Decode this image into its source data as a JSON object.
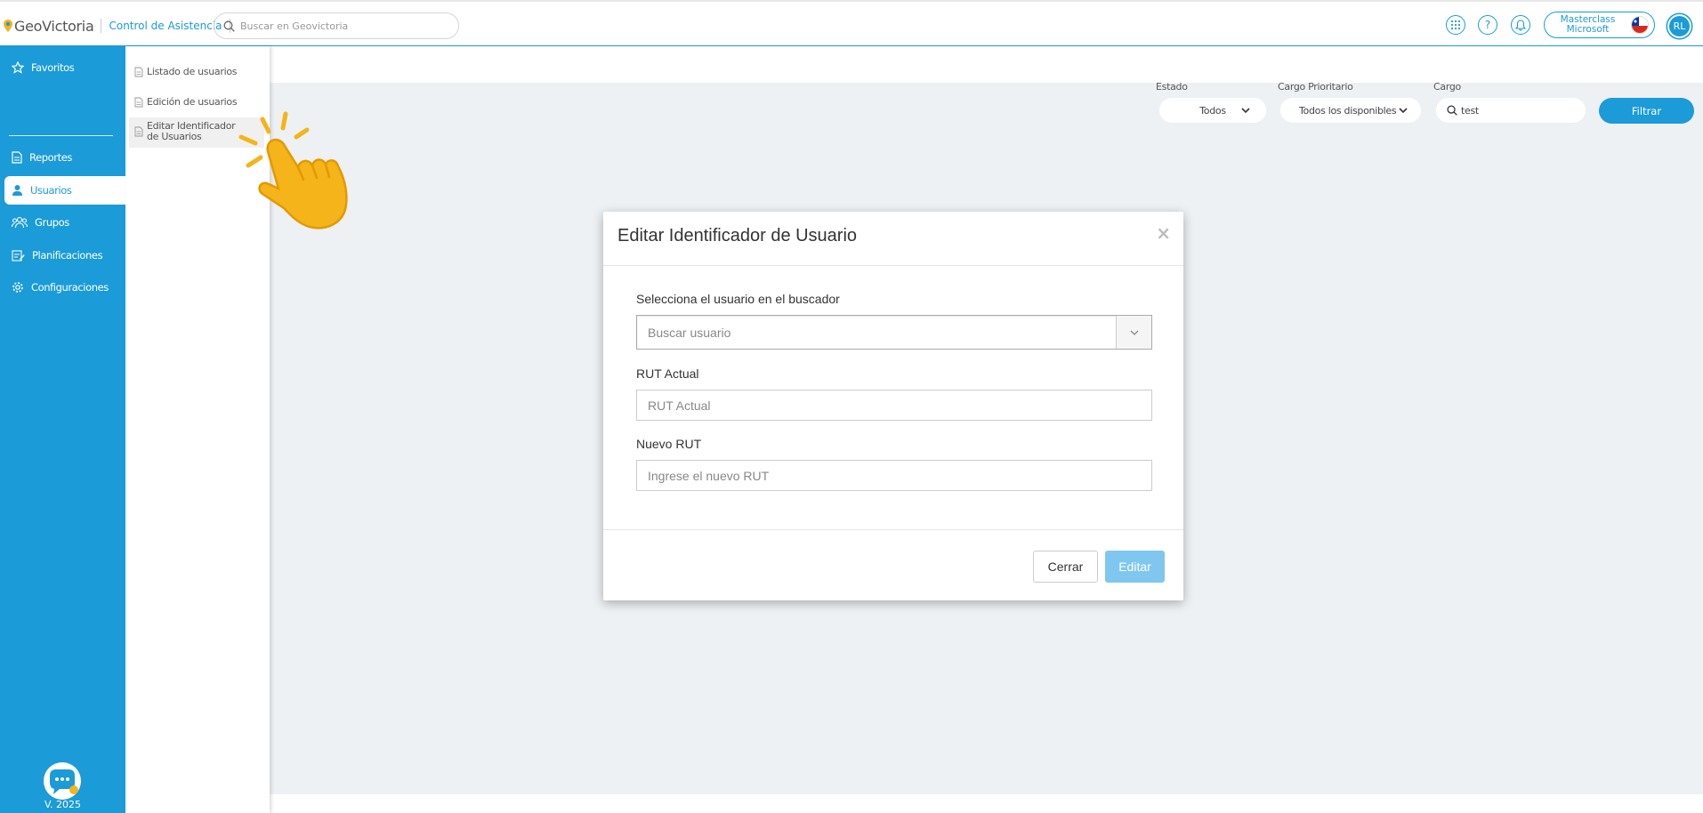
{
  "topbar": {
    "logo_text": "GeoVictoria",
    "module_name": "Control de Asistencia",
    "search_placeholder": "Buscar en Geovictoria",
    "company_line1": "Masterclass",
    "company_line2": "Microsoft",
    "avatar_initials": "RL",
    "icons": [
      "apps-grid-icon",
      "help-icon",
      "bell-icon"
    ]
  },
  "sidebar": {
    "items": [
      {
        "label": "Favoritos",
        "icon": "star-icon"
      },
      {
        "label": "Reportes",
        "icon": "document-icon"
      },
      {
        "label": "Usuarios",
        "icon": "user-icon"
      },
      {
        "label": "Grupos",
        "icon": "group-icon"
      },
      {
        "label": "Planificaciones",
        "icon": "calendar-edit-icon"
      },
      {
        "label": "Configuraciones",
        "icon": "gear-icon"
      }
    ],
    "active": "Usuarios",
    "version": "V. 2025"
  },
  "submenu": {
    "items": [
      {
        "label": "Listado de usuarios"
      },
      {
        "label": "Edición de usuarios"
      },
      {
        "label": "Editar Identificador de Usuarios"
      }
    ]
  },
  "filters": {
    "estado_label": "Estado",
    "estado_value": "Todos",
    "cargo_prioritario_label": "Cargo Prioritario",
    "cargo_prioritario_value": "Todos los disponibles",
    "cargo_label": "Cargo",
    "cargo_value": "test",
    "filter_button": "Filtrar"
  },
  "modal": {
    "title": "Editar Identificador de Usuario",
    "close": "×",
    "user_search_label": "Selecciona el usuario en el buscador",
    "user_search_placeholder": "Buscar usuario",
    "rut_actual_label": "RUT Actual",
    "rut_actual_placeholder": "RUT Actual",
    "nuevo_rut_label": "Nuevo RUT",
    "nuevo_rut_placeholder": "Ingrese el nuevo RUT",
    "cancel_label": "Cerrar",
    "submit_label": "Editar"
  },
  "colors": {
    "primary": "#1b9bd7",
    "content_bg": "#eef1f4",
    "submit_disabled": "#7fc7ef",
    "hand": "#f5b41a"
  }
}
